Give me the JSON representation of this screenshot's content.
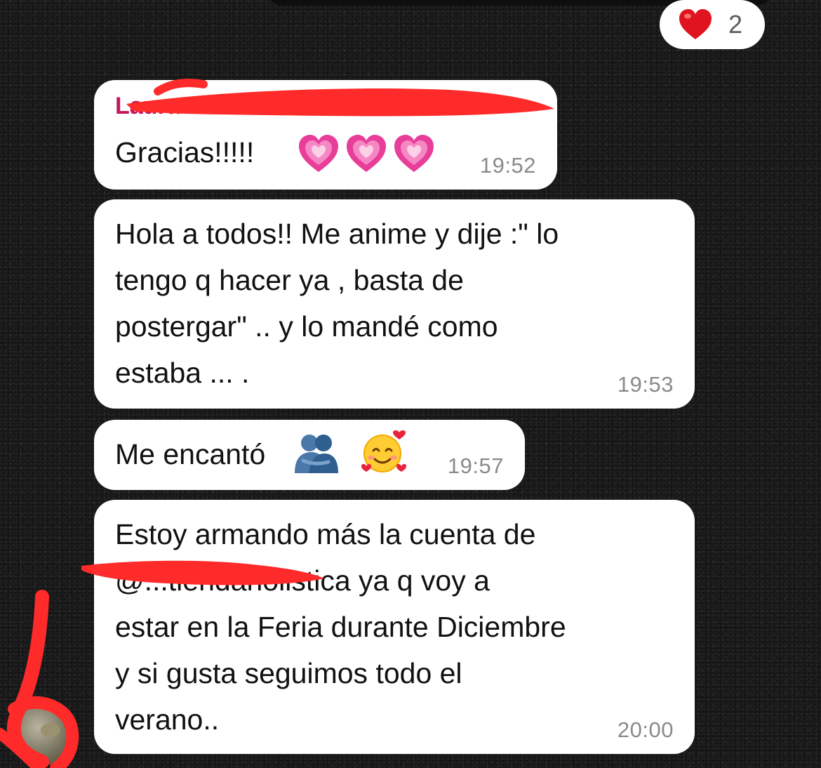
{
  "reaction": {
    "emoji": "heart-icon",
    "count": "2"
  },
  "messages": [
    {
      "sender": "Laura ... MADE",
      "text": "Gracias!!!!!",
      "emojis": [
        "pink-heart-icon",
        "pink-heart-icon",
        "pink-heart-icon"
      ],
      "time": "19:52"
    },
    {
      "text": "Hola a todos!! Me anime y dije :\" lo\ntengo q hacer ya , basta de\npostergar\" .. y lo mandé como\nestaba ... .",
      "time": "19:53"
    },
    {
      "text": "Me encantó",
      "emojis": [
        "hugging-people-icon",
        "smiling-face-with-hearts-icon"
      ],
      "time": "19:57"
    },
    {
      "text": "Estoy armando más la cuenta de\n@...tiendaholistica ya q voy a\nestar en la Feria durante Diciembre\ny si gusta seguimos todo el\nverano..",
      "time": "20:00"
    }
  ],
  "colors": {
    "background": "#1b1b1b",
    "bubble": "#ffffff",
    "sender_name": "#c2185b",
    "timestamp": "#8a8a8a",
    "redaction_marker": "#ff2a2a"
  }
}
